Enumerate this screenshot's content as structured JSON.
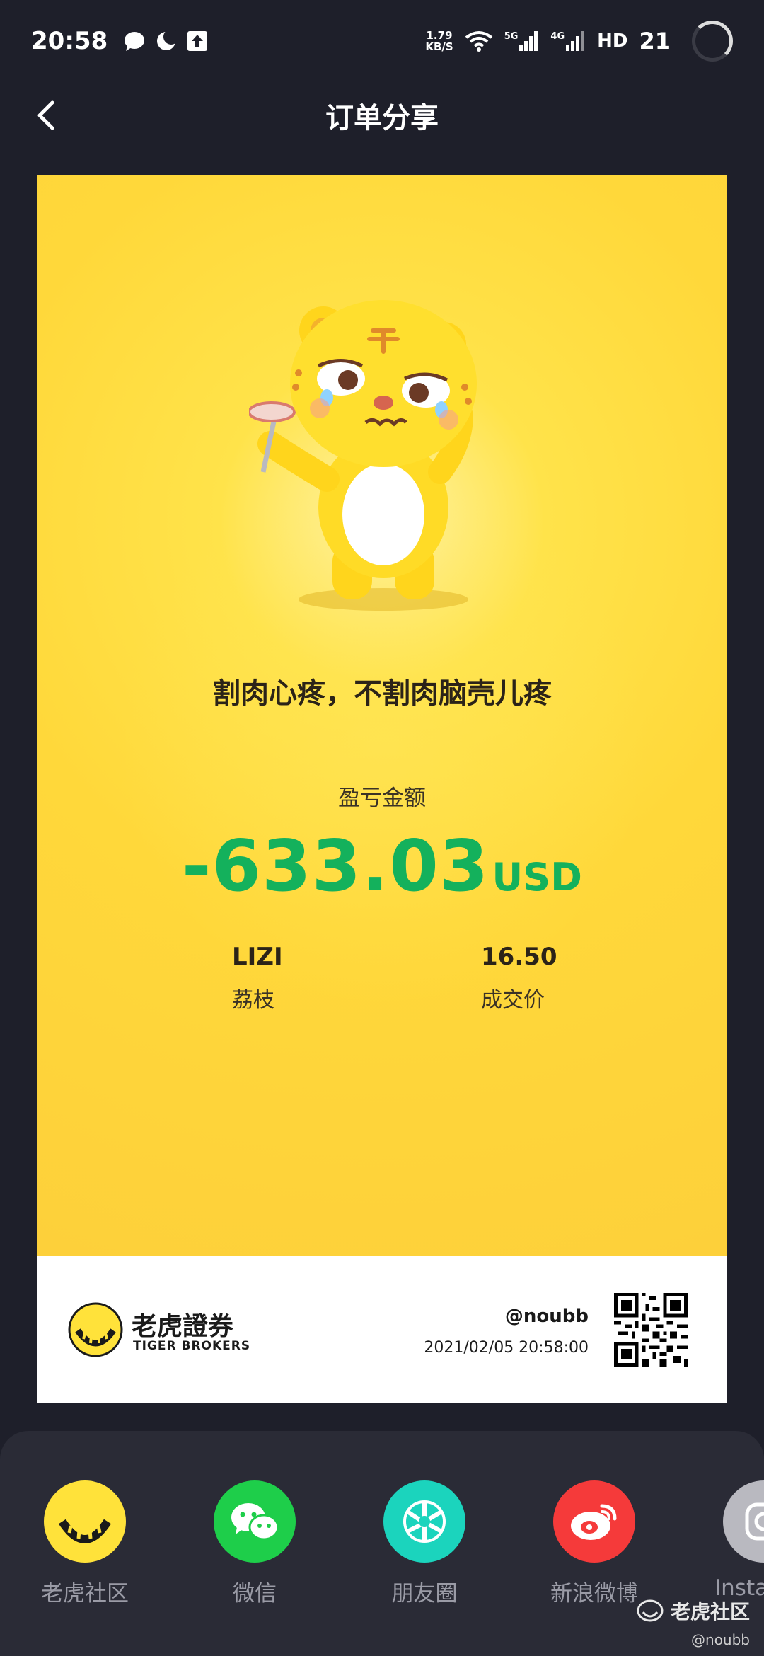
{
  "status_bar": {
    "time": "20:58",
    "net_speed_value": "1.79",
    "net_speed_unit": "KB/S",
    "signal_5g": "5G",
    "signal_4g": "4G",
    "hd_label": "HD",
    "battery": "21",
    "icons": [
      "chat-bubble-icon",
      "moon-icon",
      "upload-icon",
      "wifi-icon",
      "signal-icon",
      "signal-icon"
    ]
  },
  "nav": {
    "title": "订单分享",
    "back_icon": "chevron-left-icon"
  },
  "card": {
    "tagline": "割肉心疼，不割肉脑壳儿疼",
    "pnl_label": "盈亏金额",
    "pnl_value": "-633.03",
    "pnl_currency": "USD",
    "pnl_color": "#14b15c",
    "symbol": "LIZI",
    "symbol_name": "荔枝",
    "price": "16.50",
    "price_label": "成交价",
    "brand_cn": "老虎證券",
    "brand_en": "TIGER BROKERS",
    "user_handle": "@noubb",
    "share_time": "2021/02/05 20:58:00"
  },
  "share_targets": [
    {
      "label": "老虎社区",
      "icon": "tiger-icon",
      "color": "#ffe23a"
    },
    {
      "label": "微信",
      "icon": "wechat-icon",
      "color": "#1ece4a"
    },
    {
      "label": "朋友圈",
      "icon": "moments-icon",
      "color": "#1bd4bd"
    },
    {
      "label": "新浪微博",
      "icon": "weibo-icon",
      "color": "#f53a3a"
    },
    {
      "label": "Insta",
      "icon": "instagram-icon",
      "color": "#b9b9c0"
    }
  ],
  "watermark": {
    "title": "老虎社区",
    "user": "@noubb"
  }
}
